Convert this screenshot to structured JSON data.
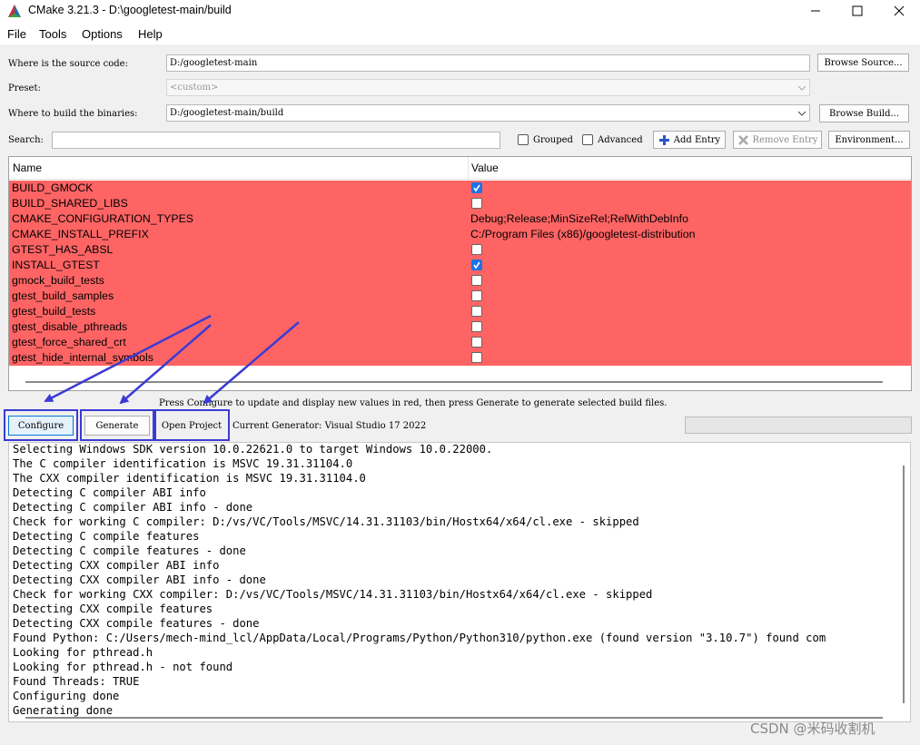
{
  "window": {
    "title": "CMake 3.21.3 - D:\\googletest-main/build"
  },
  "menu": [
    "File",
    "Tools",
    "Options",
    "Help"
  ],
  "source": {
    "label": "Where is the source code:",
    "value": "D:/googletest-main",
    "button": "Browse Source..."
  },
  "preset": {
    "label": "Preset:",
    "value": "<custom>"
  },
  "build": {
    "label": "Where to build the binaries:",
    "value": "D:/googletest-main/build",
    "button": "Browse Build..."
  },
  "search": {
    "label": "Search:",
    "value": ""
  },
  "options": {
    "grouped": "Grouped",
    "advanced": "Advanced",
    "add_entry": "Add Entry",
    "remove_entry": "Remove Entry",
    "environment": "Environment..."
  },
  "table": {
    "headers": [
      "Name",
      "Value"
    ],
    "rows": [
      {
        "name": "BUILD_GMOCK",
        "type": "bool",
        "checked": true,
        "value": ""
      },
      {
        "name": "BUILD_SHARED_LIBS",
        "type": "bool",
        "checked": false,
        "value": ""
      },
      {
        "name": "CMAKE_CONFIGURATION_TYPES",
        "type": "text",
        "checked": false,
        "value": "Debug;Release;MinSizeRel;RelWithDebInfo"
      },
      {
        "name": "CMAKE_INSTALL_PREFIX",
        "type": "text",
        "checked": false,
        "value": "C:/Program Files (x86)/googletest-distribution"
      },
      {
        "name": "GTEST_HAS_ABSL",
        "type": "bool",
        "checked": false,
        "value": ""
      },
      {
        "name": "INSTALL_GTEST",
        "type": "bool",
        "checked": true,
        "value": ""
      },
      {
        "name": "gmock_build_tests",
        "type": "bool",
        "checked": false,
        "value": ""
      },
      {
        "name": "gtest_build_samples",
        "type": "bool",
        "checked": false,
        "value": ""
      },
      {
        "name": "gtest_build_tests",
        "type": "bool",
        "checked": false,
        "value": ""
      },
      {
        "name": "gtest_disable_pthreads",
        "type": "bool",
        "checked": false,
        "value": ""
      },
      {
        "name": "gtest_force_shared_crt",
        "type": "bool",
        "checked": false,
        "value": ""
      },
      {
        "name": "gtest_hide_internal_symbols",
        "type": "bool",
        "checked": false,
        "value": ""
      }
    ]
  },
  "hint": "Press Configure to update and display new values in red, then press Generate to generate selected build files.",
  "actions": {
    "configure": "Configure",
    "generate": "Generate",
    "open_project": "Open Project",
    "generator": "Current Generator: Visual Studio 17 2022"
  },
  "log": [
    "Selecting Windows SDK version 10.0.22621.0 to target Windows 10.0.22000.",
    "The C compiler identification is MSVC 19.31.31104.0",
    "The CXX compiler identification is MSVC 19.31.31104.0",
    "Detecting C compiler ABI info",
    "Detecting C compiler ABI info - done",
    "Check for working C compiler: D:/vs/VC/Tools/MSVC/14.31.31103/bin/Hostx64/x64/cl.exe - skipped",
    "Detecting C compile features",
    "Detecting C compile features - done",
    "Detecting CXX compiler ABI info",
    "Detecting CXX compiler ABI info - done",
    "Check for working CXX compiler: D:/vs/VC/Tools/MSVC/14.31.31103/bin/Hostx64/x64/cl.exe - skipped",
    "Detecting CXX compile features",
    "Detecting CXX compile features - done",
    "Found Python: C:/Users/mech-mind_lcl/AppData/Local/Programs/Python/Python310/python.exe (found version \"3.10.7\") found com",
    "Looking for pthread.h",
    "Looking for pthread.h - not found",
    "Found Threads: TRUE",
    "Configuring done",
    "Generating done"
  ],
  "watermark": "CSDN @米码收割机",
  "colors": {
    "changed_row": "#ff6464",
    "annotation": "#3b3bd4",
    "check_on": "#1a73e8"
  }
}
